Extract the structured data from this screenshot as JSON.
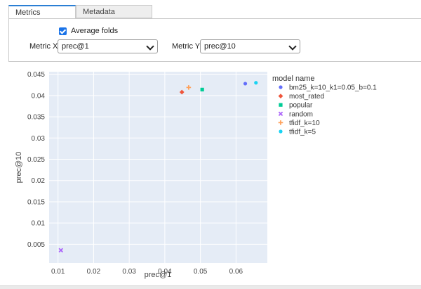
{
  "tabs": {
    "metrics": "Metrics",
    "metadata": "Metadata"
  },
  "controls": {
    "average_folds_label": "Average folds",
    "average_folds_checked": true,
    "metric_x_label": "Metric X:",
    "metric_x_value": "prec@1",
    "metric_y_label": "Metric Y:",
    "metric_y_value": "prec@10"
  },
  "colors": {
    "plot_bg": "#e5ecf6",
    "grid": "#ffffff",
    "tab_accent": "#2b7fd4",
    "checkbox": "#1a73e8"
  },
  "chart_data": {
    "type": "scatter",
    "xlabel": "prec@1",
    "ylabel": "prec@10",
    "xlim": [
      0.0075,
      0.0688
    ],
    "ylim": [
      0.0006,
      0.0456
    ],
    "xticks": [
      {
        "v": 0.01,
        "label": "0.01"
      },
      {
        "v": 0.02,
        "label": "0.02"
      },
      {
        "v": 0.03,
        "label": "0.03"
      },
      {
        "v": 0.04,
        "label": "0.04"
      },
      {
        "v": 0.05,
        "label": "0.05"
      },
      {
        "v": 0.06,
        "label": "0.06"
      }
    ],
    "yticks": [
      {
        "v": 0.005,
        "label": "0.005"
      },
      {
        "v": 0.01,
        "label": "0.01"
      },
      {
        "v": 0.015,
        "label": "0.015"
      },
      {
        "v": 0.02,
        "label": "0.02"
      },
      {
        "v": 0.025,
        "label": "0.025"
      },
      {
        "v": 0.03,
        "label": "0.03"
      },
      {
        "v": 0.035,
        "label": "0.035"
      },
      {
        "v": 0.04,
        "label": "0.04"
      },
      {
        "v": 0.045,
        "label": "0.045"
      }
    ],
    "legend_title": "model name",
    "legend_position": "right",
    "series": [
      {
        "name": "bm25_k=10_k1=0.05_b=0.1",
        "color": "#636efa",
        "symbol": "circle",
        "x": 0.0626,
        "y": 0.0428
      },
      {
        "name": "most_rated",
        "color": "#ef553b",
        "symbol": "diamond",
        "x": 0.0448,
        "y": 0.0408
      },
      {
        "name": "popular",
        "color": "#00cc96",
        "symbol": "square",
        "x": 0.0505,
        "y": 0.0414
      },
      {
        "name": "random",
        "color": "#ab63fa",
        "symbol": "x",
        "x": 0.0108,
        "y": 0.0036
      },
      {
        "name": "tfidf_k=10",
        "color": "#ffa15a",
        "symbol": "cross",
        "x": 0.0467,
        "y": 0.0419
      },
      {
        "name": "tfidf_k=5",
        "color": "#19d3f3",
        "symbol": "circle",
        "x": 0.0656,
        "y": 0.043
      }
    ]
  }
}
